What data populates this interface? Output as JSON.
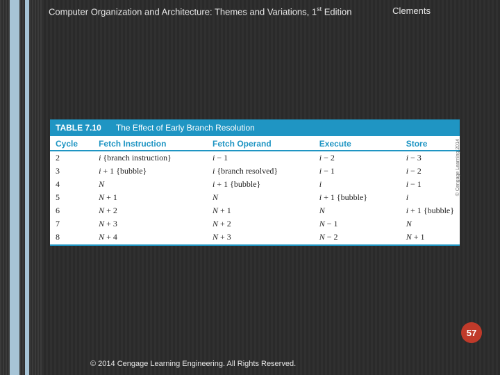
{
  "header": {
    "title_prefix": "Computer Organization and Architecture: Themes and Variations, 1",
    "title_sup": "st",
    "title_suffix": " Edition",
    "author": "Clements"
  },
  "table": {
    "label": "TABLE 7.10",
    "caption": "The Effect of Early Branch Resolution",
    "columns": [
      "Cycle",
      "Fetch Instruction",
      "Fetch Operand",
      "Execute",
      "Store"
    ],
    "rows": [
      {
        "cycle": "2",
        "fi": {
          "v": "i",
          "ann": "{branch instruction}"
        },
        "fo": {
          "v": "i",
          "d": "− 1"
        },
        "ex": {
          "v": "i",
          "d": "− 2"
        },
        "st": {
          "v": "i",
          "d": "− 3"
        }
      },
      {
        "cycle": "3",
        "fi": {
          "v": "i",
          "d": "+ 1",
          "ann": "{bubble}"
        },
        "fo": {
          "v": "i",
          "ann": "{branch resolved}"
        },
        "ex": {
          "v": "i",
          "d": "− 1"
        },
        "st": {
          "v": "i",
          "d": "− 2"
        }
      },
      {
        "cycle": "4",
        "fi": {
          "v": "N"
        },
        "fo": {
          "v": "i",
          "d": "+ 1",
          "ann": "{bubble}"
        },
        "ex": {
          "v": "i"
        },
        "st": {
          "v": "i",
          "d": "− 1"
        }
      },
      {
        "cycle": "5",
        "fi": {
          "v": "N",
          "d": "+ 1"
        },
        "fo": {
          "v": "N"
        },
        "ex": {
          "v": "i",
          "d": "+ 1",
          "ann": "{bubble}"
        },
        "st": {
          "v": "i"
        }
      },
      {
        "cycle": "6",
        "fi": {
          "v": "N",
          "d": "+ 2"
        },
        "fo": {
          "v": "N",
          "d": "+ 1"
        },
        "ex": {
          "v": "N"
        },
        "st": {
          "v": "i",
          "d": "+ 1",
          "ann": "{bubble}"
        }
      },
      {
        "cycle": "7",
        "fi": {
          "v": "N",
          "d": "+ 3"
        },
        "fo": {
          "v": "N",
          "d": "+ 2"
        },
        "ex": {
          "v": "N",
          "d": "− 1"
        },
        "st": {
          "v": "N"
        }
      },
      {
        "cycle": "8",
        "fi": {
          "v": "N",
          "d": "+ 4"
        },
        "fo": {
          "v": "N",
          "d": "+ 3"
        },
        "ex": {
          "v": "N",
          "d": "− 2"
        },
        "st": {
          "v": "N",
          "d": "+ 1"
        }
      }
    ]
  },
  "side_credit": "© Cengage Learning 2014",
  "page_number": "57",
  "footer": "© 2014 Cengage Learning Engineering. All Rights Reserved."
}
